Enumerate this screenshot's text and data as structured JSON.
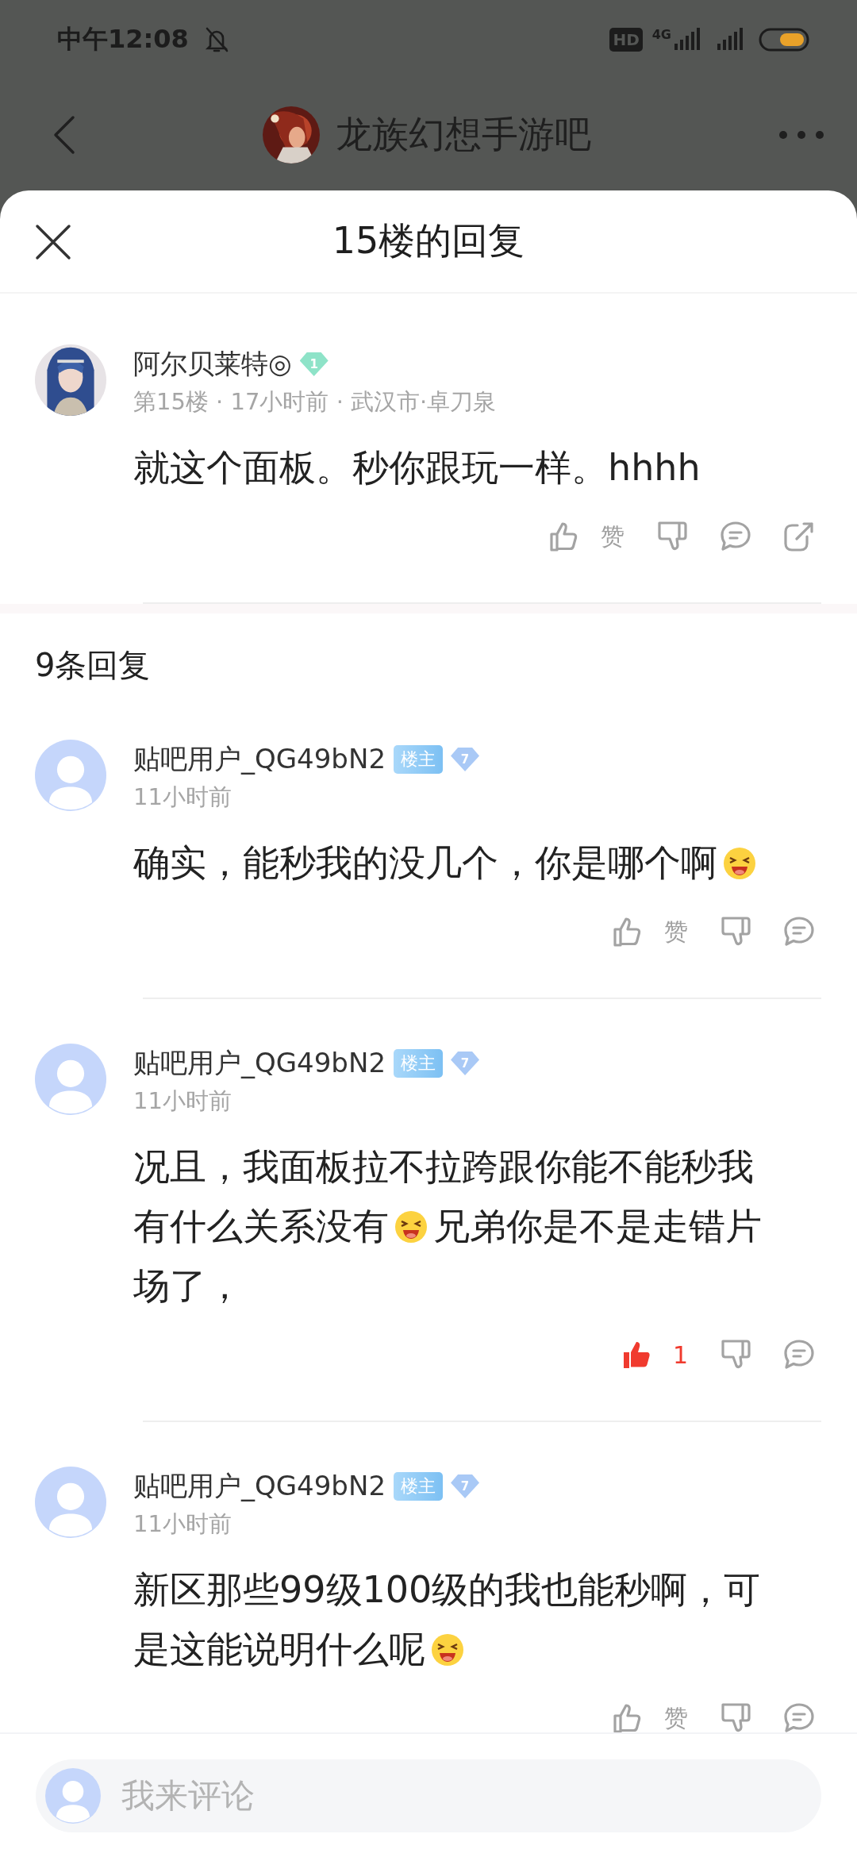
{
  "status_bar": {
    "time": "中午12:08",
    "hd": "HD",
    "network": "4G"
  },
  "forum": {
    "title": "龙族幻想手游吧"
  },
  "sheet": {
    "title": "15楼的回复"
  },
  "post": {
    "avatar": {
      "kind": "picture"
    },
    "author": "阿尔贝莱特◎",
    "level": {
      "text": "1",
      "color": "#8ee3c8"
    },
    "meta": "第15楼 · 17小时前 · 武汉市·卓刀泉",
    "body": [
      [
        {
          "kind": "text",
          "text": "就这个面板。秒你跟玩一样。hhhh"
        }
      ]
    ],
    "actions": [
      {
        "kind": "like",
        "label": "赞",
        "liked": false
      },
      {
        "kind": "dislike"
      },
      {
        "kind": "comment"
      },
      {
        "kind": "share"
      }
    ]
  },
  "reply_count": "9条回复",
  "replies": [
    {
      "author": "贴吧用户_QG49bN2",
      "tag": "楼主",
      "level": {
        "text": "7",
        "color": "#a9c9f6"
      },
      "time": "11小时前",
      "body": [
        [
          {
            "kind": "text",
            "text": "确实，能秒我的没几个，你是哪个啊"
          },
          {
            "kind": "emoji"
          }
        ]
      ],
      "actions": [
        {
          "kind": "like",
          "label": "赞",
          "liked": false
        },
        {
          "kind": "dislike"
        },
        {
          "kind": "comment"
        }
      ]
    },
    {
      "author": "贴吧用户_QG49bN2",
      "tag": "楼主",
      "level": {
        "text": "7",
        "color": "#a9c9f6"
      },
      "time": "11小时前",
      "body": [
        [
          {
            "kind": "text",
            "text": "况且，我面板拉不拉跨跟你能不能秒我"
          }
        ],
        [
          {
            "kind": "text",
            "text": "有什么关系没有"
          },
          {
            "kind": "emoji"
          },
          {
            "kind": "text",
            "text": "兄弟你是不是走错片"
          }
        ],
        [
          {
            "kind": "text",
            "text": "场了，"
          }
        ]
      ],
      "actions": [
        {
          "kind": "like",
          "label": "1",
          "liked": true
        },
        {
          "kind": "dislike"
        },
        {
          "kind": "comment"
        }
      ]
    },
    {
      "author": "贴吧用户_QG49bN2",
      "tag": "楼主",
      "level": {
        "text": "7",
        "color": "#a9c9f6"
      },
      "time": "11小时前",
      "body": [
        [
          {
            "kind": "text",
            "text": "新区那些99级100级的我也能秒啊，可"
          }
        ],
        [
          {
            "kind": "text",
            "text": "是这能说明什么呢"
          },
          {
            "kind": "emoji"
          }
        ]
      ],
      "actions": [
        {
          "kind": "like",
          "label": "赞",
          "liked": false
        },
        {
          "kind": "dislike"
        },
        {
          "kind": "comment"
        }
      ]
    }
  ],
  "comment_box": {
    "placeholder": "我来评论"
  }
}
